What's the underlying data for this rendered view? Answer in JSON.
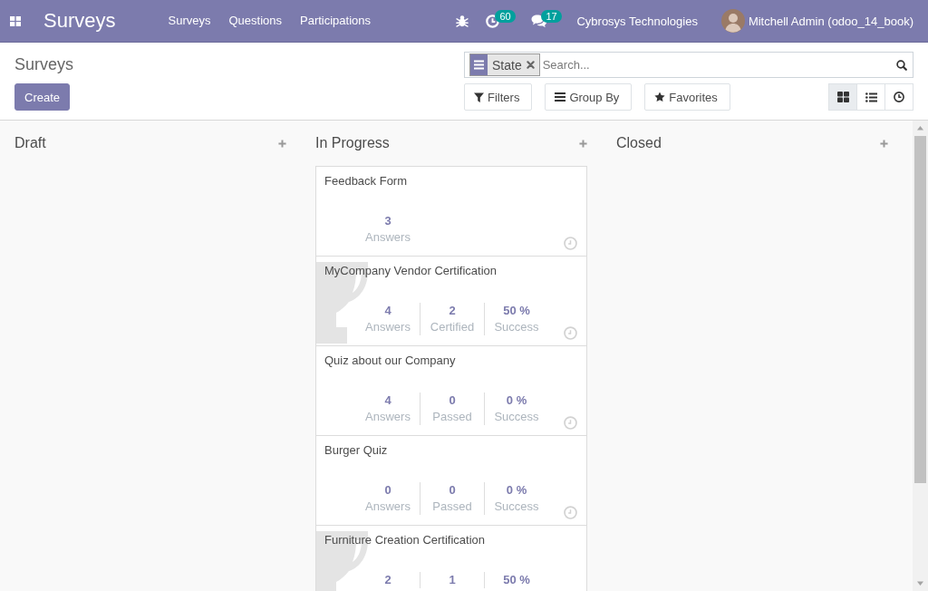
{
  "navbar": {
    "app_name": "Surveys",
    "menu": [
      {
        "label": "Surveys"
      },
      {
        "label": "Questions"
      },
      {
        "label": "Participations"
      }
    ],
    "systray": [
      {
        "kind": "debug"
      },
      {
        "kind": "activity",
        "badge": "60"
      },
      {
        "kind": "messages",
        "badge": "17"
      }
    ],
    "company": "Cybrosys Technologies",
    "user": "Mitchell Admin (odoo_14_book)"
  },
  "control_panel": {
    "breadcrumb": "Surveys",
    "create_button": "Create",
    "search": {
      "facets": [
        {
          "label": "State"
        }
      ],
      "placeholder": "Search..."
    },
    "search_buttons": [
      {
        "kind": "filters",
        "label": "Filters"
      },
      {
        "kind": "group_by",
        "label": "Group By"
      },
      {
        "kind": "favorites",
        "label": "Favorites"
      }
    ],
    "views": [
      {
        "kind": "kanban",
        "selected": true
      },
      {
        "kind": "list",
        "selected": false
      },
      {
        "kind": "activity",
        "selected": false
      }
    ]
  },
  "kanban": {
    "columns": [
      {
        "title": "Draft"
      },
      {
        "title": "In Progress",
        "cards": [
          {
            "title": "Feedback Form",
            "certification": false,
            "activity": true,
            "stats": [
              {
                "value": "3",
                "label": "Answers"
              }
            ]
          },
          {
            "title": "MyCompany Vendor Certification",
            "certification": true,
            "activity": true,
            "stats": [
              {
                "value": "4",
                "label": "Answers"
              },
              {
                "value": "2",
                "label": "Certified"
              },
              {
                "value": "50 %",
                "label": "Success"
              }
            ]
          },
          {
            "title": "Quiz about our Company",
            "certification": false,
            "activity": true,
            "stats": [
              {
                "value": "4",
                "label": "Answers"
              },
              {
                "value": "0",
                "label": "Passed"
              },
              {
                "value": "0 %",
                "label": "Success"
              }
            ]
          },
          {
            "title": "Burger Quiz",
            "certification": false,
            "activity": true,
            "stats": [
              {
                "value": "0",
                "label": "Answers"
              },
              {
                "value": "0",
                "label": "Passed"
              },
              {
                "value": "0 %",
                "label": "Success"
              }
            ]
          },
          {
            "title": "Furniture Creation Certification",
            "certification": true,
            "stats": [
              {
                "value": "2"
              },
              {
                "value": "1"
              },
              {
                "value": "50 %"
              }
            ]
          }
        ]
      },
      {
        "title": "Closed"
      }
    ]
  }
}
